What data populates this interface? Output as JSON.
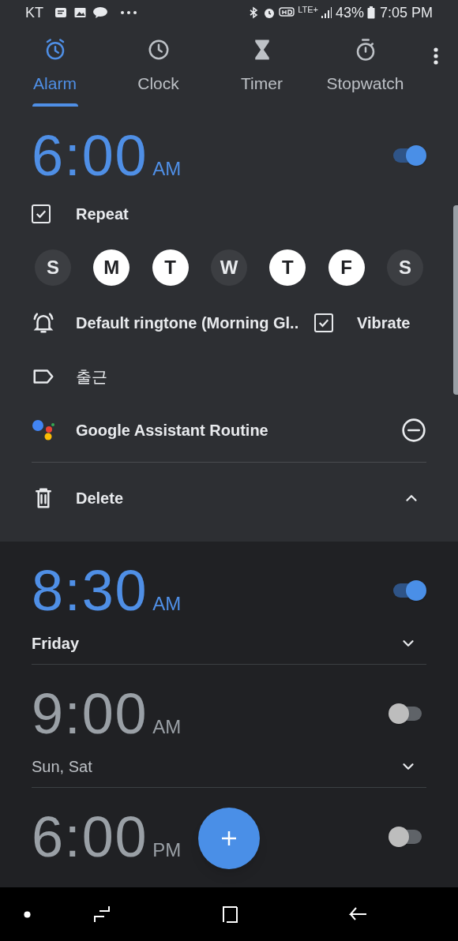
{
  "status_bar": {
    "carrier": "KT",
    "network": "LTE+",
    "battery": "43%",
    "time": "7:05 PM"
  },
  "tabs": [
    {
      "label": "Alarm",
      "kind": "alarm",
      "selected": true
    },
    {
      "label": "Clock",
      "kind": "clock",
      "selected": false
    },
    {
      "label": "Timer",
      "kind": "timer",
      "selected": false
    },
    {
      "label": "Stopwatch",
      "kind": "stopwatch",
      "selected": false
    }
  ],
  "alarms": [
    {
      "time": "6:00",
      "period": "AM",
      "enabled": true,
      "expanded": true,
      "repeat": {
        "label": "Repeat",
        "checked": true
      },
      "days": [
        {
          "label": "S",
          "selected": false
        },
        {
          "label": "M",
          "selected": true
        },
        {
          "label": "T",
          "selected": true
        },
        {
          "label": "W",
          "selected": false
        },
        {
          "label": "T",
          "selected": true
        },
        {
          "label": "F",
          "selected": true
        },
        {
          "label": "S",
          "selected": false
        }
      ],
      "ringtone": "Default ringtone (Morning Gl..",
      "vibrate": {
        "label": "Vibrate",
        "checked": true
      },
      "label": "출근",
      "routine": "Google Assistant Routine",
      "delete": "Delete"
    },
    {
      "time": "8:30",
      "period": "AM",
      "enabled": true,
      "expanded": false,
      "summary": "Friday"
    },
    {
      "time": "9:00",
      "period": "AM",
      "enabled": false,
      "expanded": false,
      "summary": "Sun, Sat"
    },
    {
      "time": "6:00",
      "period": "PM",
      "enabled": false
    }
  ]
}
